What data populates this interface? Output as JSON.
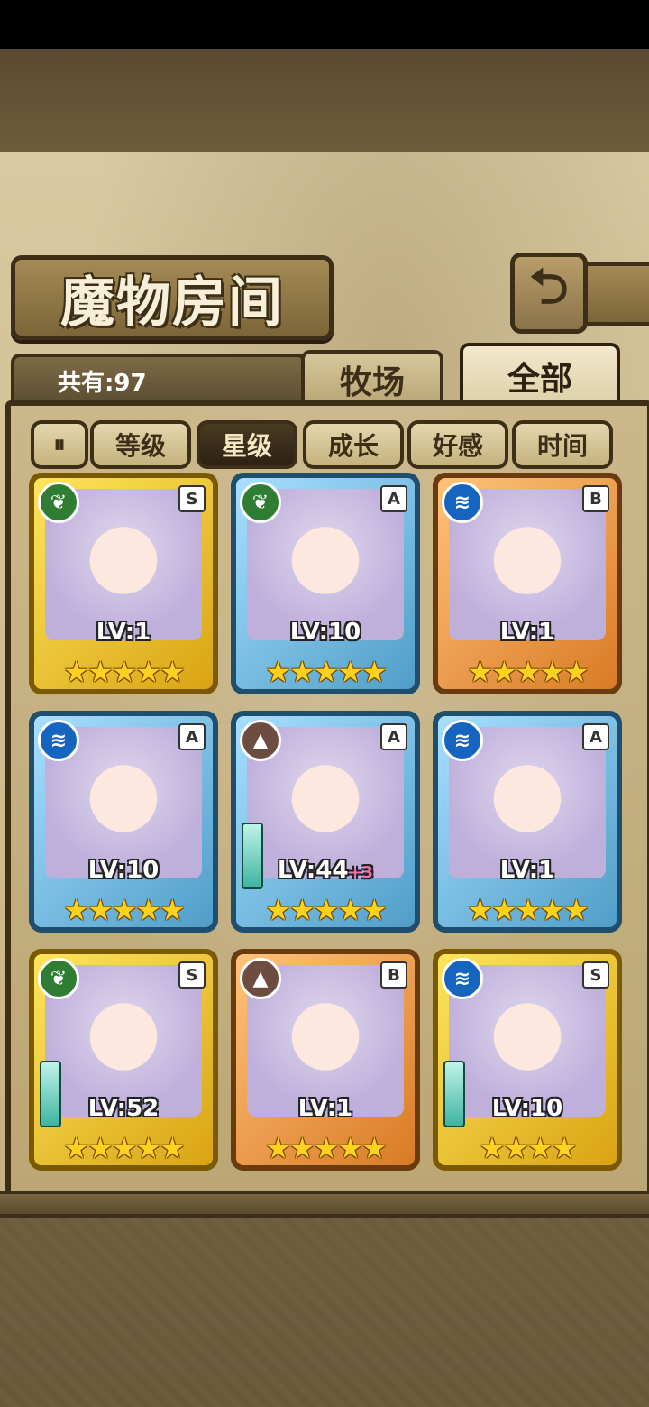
{
  "header": {
    "title": "魔物房间",
    "back_icon": "return-arrow-icon"
  },
  "info": {
    "count_label": "共有:97"
  },
  "tabs": [
    {
      "label": "牧场",
      "active": false
    },
    {
      "label": "全部",
      "active": true
    }
  ],
  "sort": {
    "toggle_label": "⏸",
    "options": [
      {
        "label": "等级",
        "active": false
      },
      {
        "label": "星级",
        "active": true
      },
      {
        "label": "成长",
        "active": false
      },
      {
        "label": "好感",
        "active": false
      },
      {
        "label": "时间",
        "active": false
      }
    ]
  },
  "monsters": [
    {
      "element": "grass",
      "rank": "S",
      "frame": "gold",
      "level": "LV:1",
      "plus": "",
      "stars": 5,
      "weapon": false
    },
    {
      "element": "grass",
      "rank": "A",
      "frame": "blue",
      "level": "LV:10",
      "plus": "",
      "stars": 5,
      "weapon": false
    },
    {
      "element": "water",
      "rank": "B",
      "frame": "orange",
      "level": "LV:1",
      "plus": "",
      "stars": 5,
      "weapon": false
    },
    {
      "element": "water",
      "rank": "A",
      "frame": "blue",
      "level": "LV:10",
      "plus": "",
      "stars": 5,
      "weapon": false
    },
    {
      "element": "earth",
      "rank": "A",
      "frame": "blue",
      "level": "LV:44",
      "plus": "+3",
      "stars": 5,
      "weapon": true
    },
    {
      "element": "water",
      "rank": "A",
      "frame": "blue",
      "level": "LV:1",
      "plus": "",
      "stars": 5,
      "weapon": false
    },
    {
      "element": "grass",
      "rank": "S",
      "frame": "gold",
      "level": "LV:52",
      "plus": "",
      "stars": 5,
      "weapon": true
    },
    {
      "element": "earth",
      "rank": "B",
      "frame": "orange",
      "level": "LV:1",
      "plus": "",
      "stars": 5,
      "weapon": false
    },
    {
      "element": "water",
      "rank": "S",
      "frame": "gold",
      "level": "LV:10",
      "plus": "",
      "stars": 4,
      "weapon": true
    }
  ],
  "colors": {
    "gold_frame": "#fde55c",
    "blue_frame": "#a8dfff",
    "orange_frame": "#ffc27a",
    "star": "#ffd21f"
  }
}
